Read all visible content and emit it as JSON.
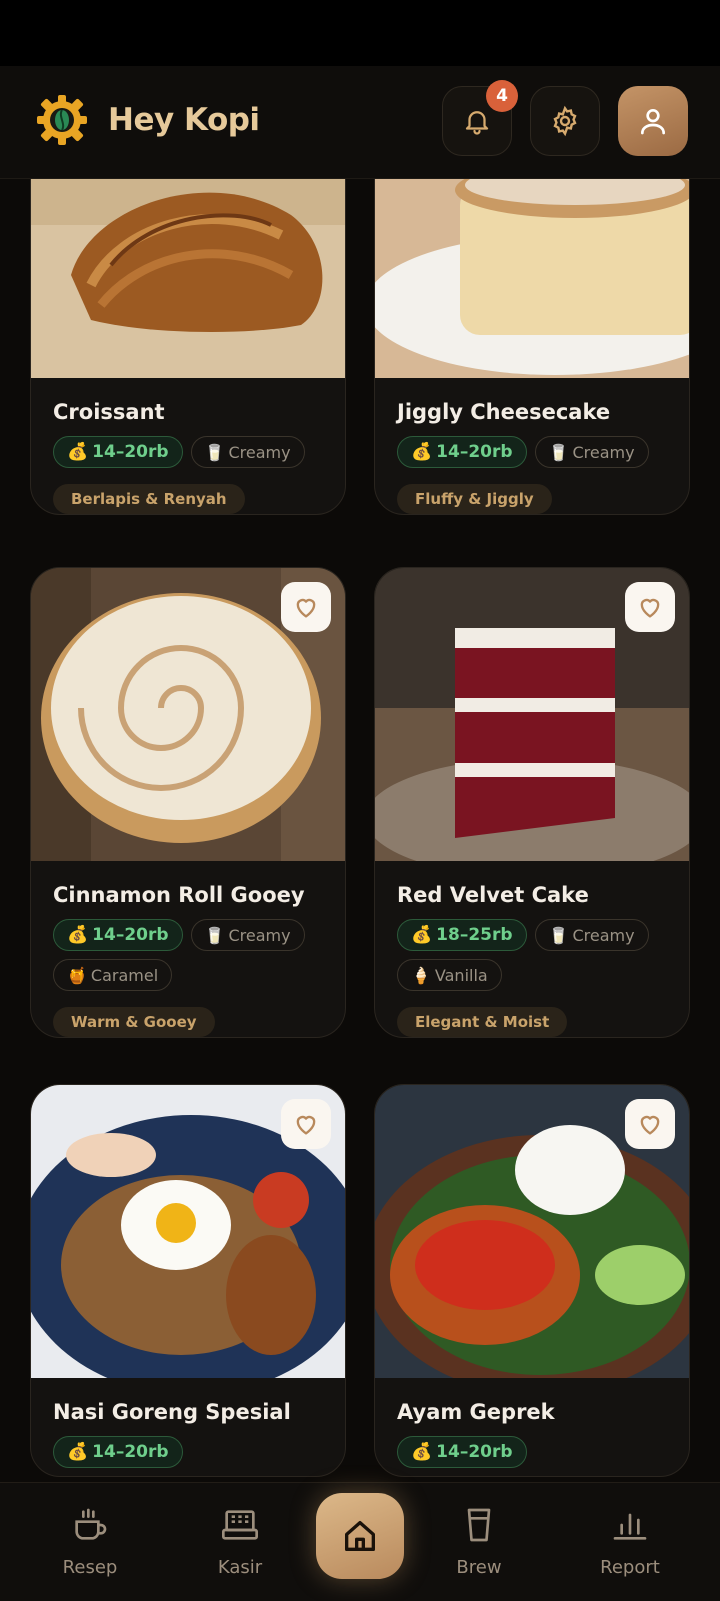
{
  "app": {
    "title": "Hey Kopi",
    "notification_count": "4"
  },
  "menu_items": [
    {
      "name": "Croissant",
      "price": "14–20rb",
      "flavors": [
        "Creamy"
      ],
      "tag": "Berlapis & Renyah"
    },
    {
      "name": "Jiggly Cheesecake",
      "price": "14–20rb",
      "flavors": [
        "Creamy"
      ],
      "tag": "Fluffy & Jiggly"
    },
    {
      "name": "Cinnamon Roll Gooey",
      "price": "14–20rb",
      "flavors": [
        "Creamy",
        "Caramel"
      ],
      "tag": "Warm & Gooey"
    },
    {
      "name": "Red Velvet Cake",
      "price": "18–25rb",
      "flavors": [
        "Creamy",
        "Vanilla"
      ],
      "tag": "Elegant & Moist"
    },
    {
      "name": "Nasi Goreng Spesial",
      "price": "14–20rb"
    },
    {
      "name": "Ayam Geprek",
      "price": "14–20rb"
    }
  ],
  "nav": {
    "resep": "Resep",
    "kasir": "Kasir",
    "brew": "Brew",
    "report": "Report"
  },
  "icons": {
    "price": "money-bag-icon",
    "creamy": "milk-glass-icon",
    "caramel": "honey-pot-icon",
    "vanilla": "ice-cream-icon",
    "favorite": "heart-outline-icon"
  },
  "colors": {
    "accent": "#d6aa6e",
    "price_green": "#6fcf8c",
    "badge": "#d9613a",
    "background": "#0c0a08"
  }
}
